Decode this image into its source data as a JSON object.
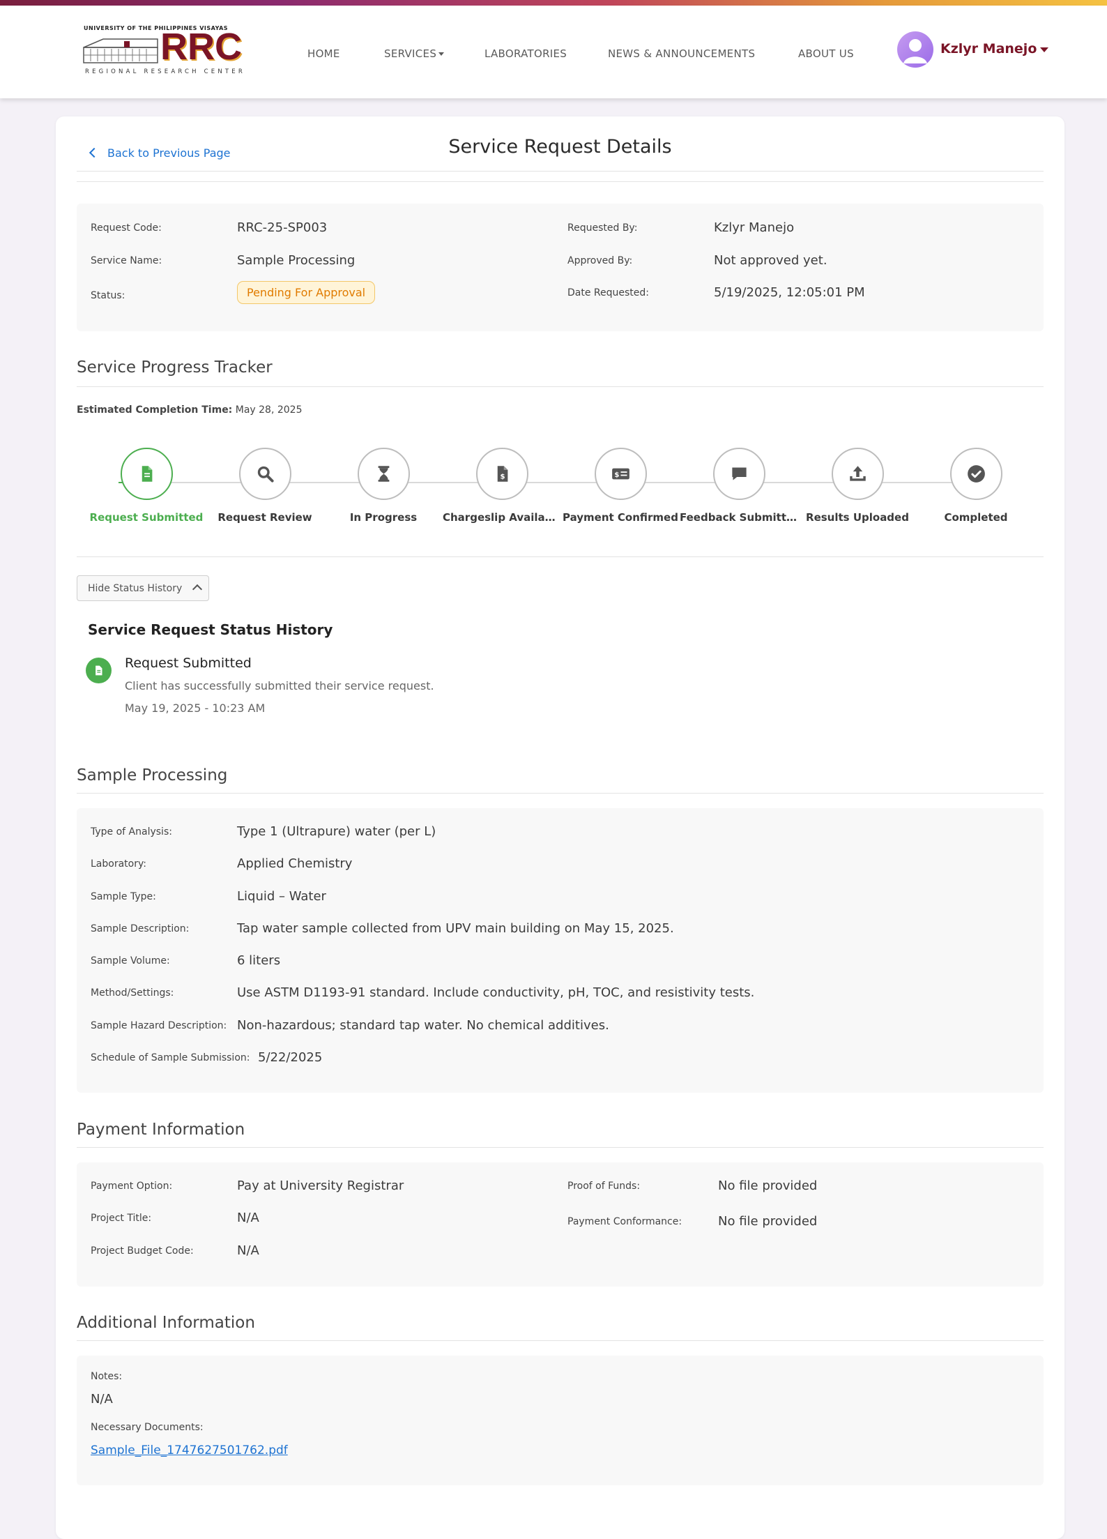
{
  "brand": {
    "university": "UNIVERSITY OF THE PHILIPPINES VISAYAS",
    "acronym": "RRC",
    "center": "REGIONAL RESEARCH CENTER"
  },
  "nav": {
    "home": "HOME",
    "services": "SERVICES",
    "laboratories": "LABORATORIES",
    "news": "NEWS & ANNOUNCEMENTS",
    "about": "ABOUT US"
  },
  "user": {
    "name": "Kzlyr Manejo"
  },
  "page": {
    "back_label": "Back to Previous Page",
    "title": "Service Request Details"
  },
  "summary": {
    "request_code_label": "Request Code:",
    "request_code": "RRC-25-SP003",
    "service_name_label": "Service Name:",
    "service_name": "Sample Processing",
    "status_label": "Status:",
    "status": "Pending For Approval",
    "requested_by_label": "Requested By:",
    "requested_by": "Kzlyr Manejo",
    "approved_by_label": "Approved By:",
    "approved_by": "Not approved yet.",
    "date_requested_label": "Date Requested:",
    "date_requested": "5/19/2025, 12:05:01 PM"
  },
  "tracker": {
    "title": "Service Progress Tracker",
    "est_label": "Estimated Completion Time:",
    "est_value": "May 28, 2025",
    "steps": [
      {
        "label": "Request Submitted",
        "icon": "document-icon",
        "active": true
      },
      {
        "label": "Request Review",
        "icon": "search-icon",
        "active": false
      },
      {
        "label": "In Progress",
        "icon": "hourglass-icon",
        "active": false
      },
      {
        "label": "Chargeslip Available",
        "icon": "invoice-icon",
        "active": false
      },
      {
        "label": "Payment Confirmed",
        "icon": "money-icon",
        "active": false
      },
      {
        "label": "Feedback Submitt...",
        "icon": "comment-icon",
        "active": false
      },
      {
        "label": "Results Uploaded",
        "icon": "upload-icon",
        "active": false
      },
      {
        "label": "Completed",
        "icon": "check-circle-icon",
        "active": false
      }
    ]
  },
  "history": {
    "toggle_label": "Hide Status History",
    "title": "Service Request Status History",
    "events": [
      {
        "title": "Request Submitted",
        "description": "Client has successfully submitted their service request.",
        "date": "May 19, 2025 - 10:23 AM"
      }
    ]
  },
  "sample": {
    "title": "Sample Processing",
    "rows": [
      {
        "label": "Type of Analysis:",
        "value": "Type 1 (Ultrapure) water (per L)"
      },
      {
        "label": "Laboratory:",
        "value": "Applied Chemistry"
      },
      {
        "label": "Sample Type:",
        "value": "Liquid – Water"
      },
      {
        "label": "Sample Description:",
        "value": "Tap water sample collected from UPV main building on May 15, 2025."
      },
      {
        "label": "Sample Volume:",
        "value": "6 liters"
      },
      {
        "label": "Method/Settings:",
        "value": "Use ASTM D1193-91 standard. Include conductivity, pH, TOC, and resistivity tests."
      },
      {
        "label": "Sample Hazard Description:",
        "value": "Non-hazardous; standard tap water. No chemical additives."
      },
      {
        "label": "Schedule of Sample Submission:",
        "value": "5/22/2025"
      }
    ]
  },
  "payment": {
    "title": "Payment Information",
    "option_label": "Payment Option:",
    "option": "Pay at University Registrar",
    "project_title_label": "Project Title:",
    "project_title": "N/A",
    "budget_code_label": "Project Budget Code:",
    "budget_code": "N/A",
    "proof_label": "Proof of Funds:",
    "proof": "No file provided",
    "conformance_label": "Payment Conformance:",
    "conformance": "No file provided"
  },
  "additional": {
    "title": "Additional Information",
    "notes_label": "Notes:",
    "notes": "N/A",
    "docs_label": "Necessary Documents:",
    "doc_file": "Sample_File_1747627501762.pdf"
  },
  "colors": {
    "brand_maroon": "#7a1426",
    "success_green": "#4cae4f",
    "link_blue": "#1e73d2",
    "pending_orange": "#e07b00"
  }
}
